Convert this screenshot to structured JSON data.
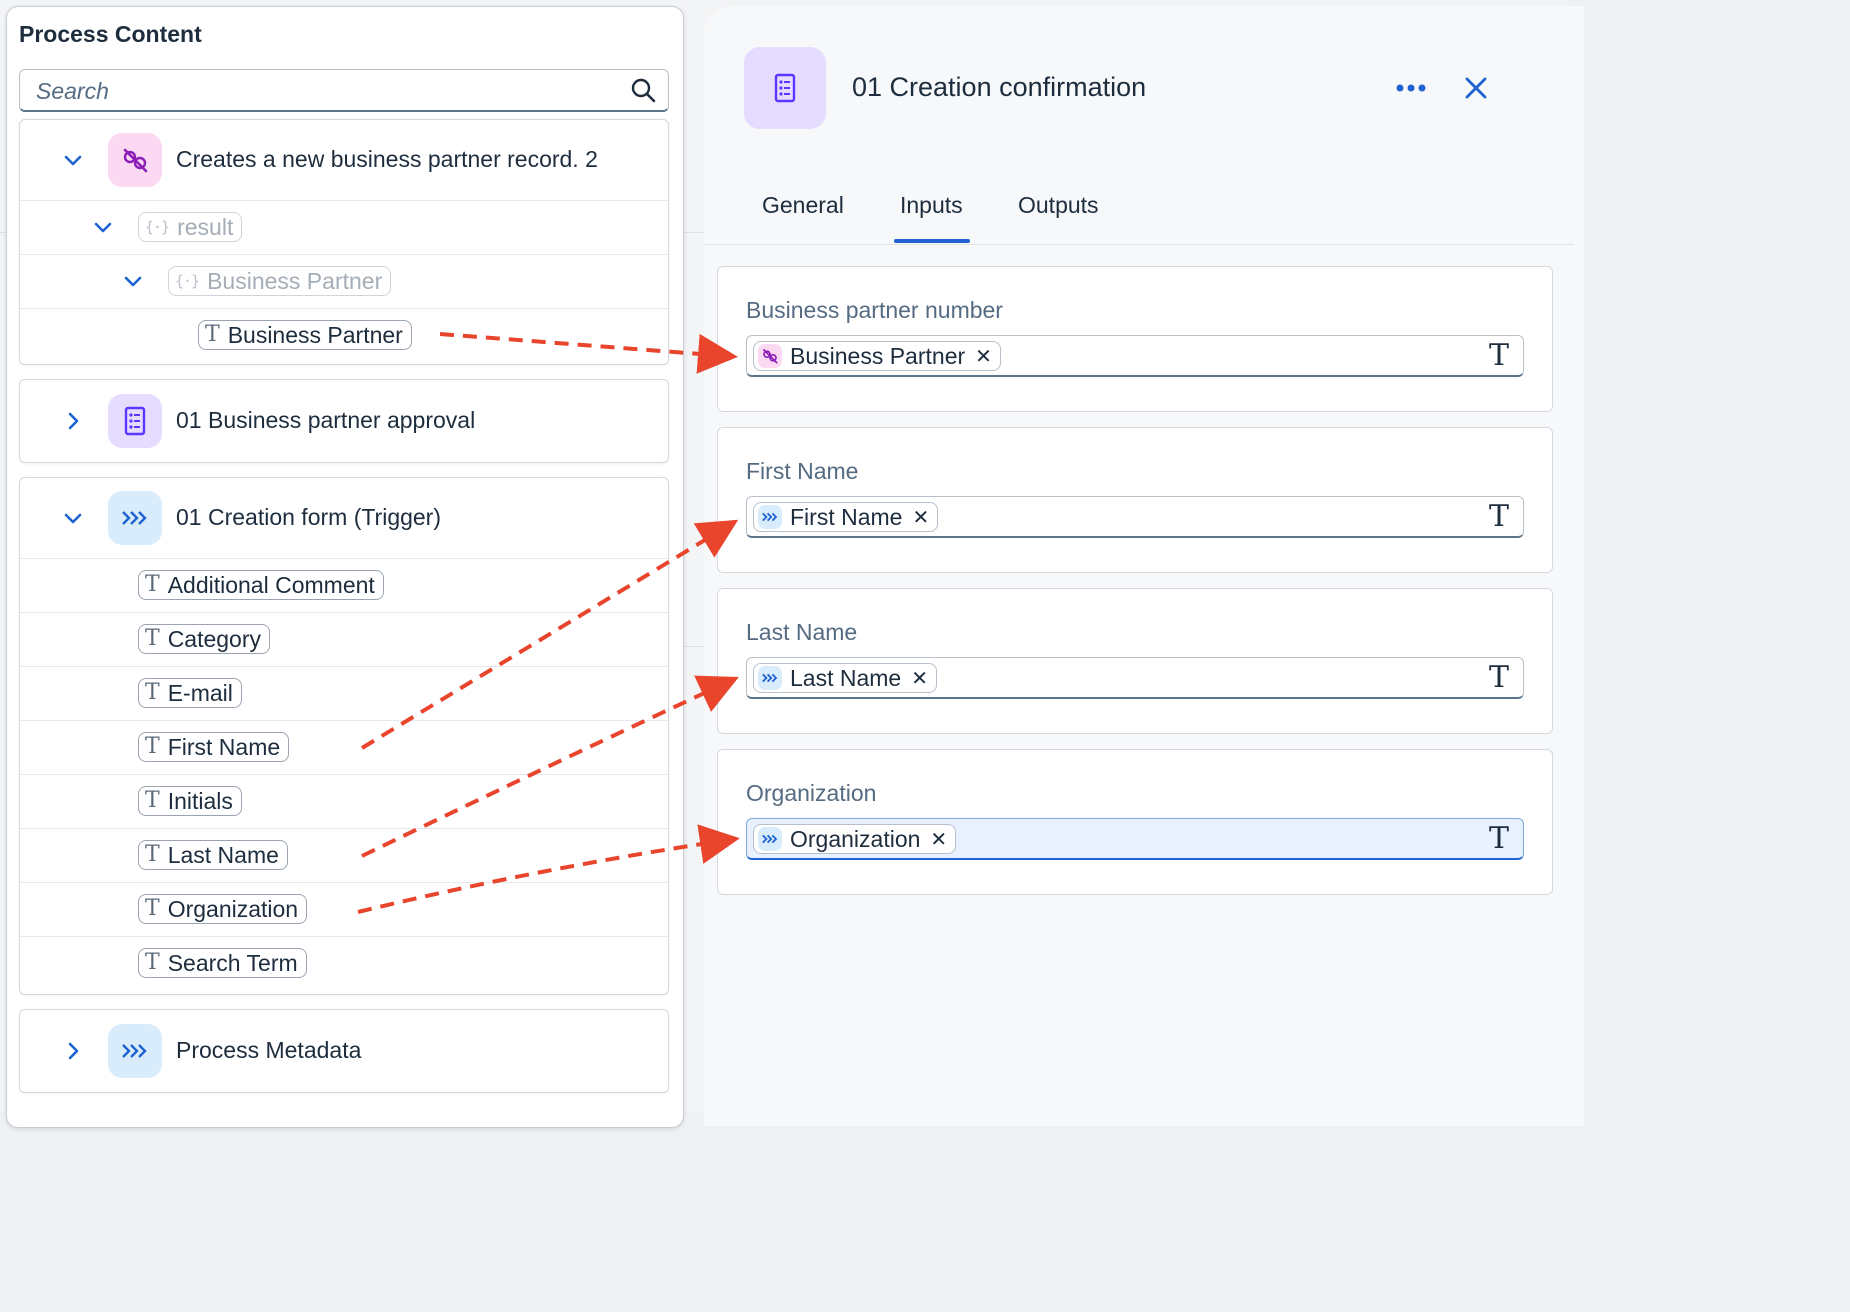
{
  "left_panel": {
    "title": "Process Content",
    "search_placeholder": "Search",
    "groups": [
      {
        "label": "Creates a new business partner record. 2",
        "children": [
          {
            "label": "result"
          },
          {
            "label": "Business Partner"
          },
          {
            "label": "Business Partner"
          }
        ]
      },
      {
        "label": "01 Business partner approval"
      },
      {
        "label": "01 Creation form (Trigger)",
        "children": [
          {
            "label": "Additional Comment"
          },
          {
            "label": "Category"
          },
          {
            "label": "E-mail"
          },
          {
            "label": "First Name"
          },
          {
            "label": "Initials"
          },
          {
            "label": "Last Name"
          },
          {
            "label": "Organization"
          },
          {
            "label": "Search Term"
          }
        ]
      },
      {
        "label": "Process Metadata"
      }
    ]
  },
  "right_panel": {
    "title": "01 Creation confirmation",
    "tabs": [
      "General",
      "Inputs",
      "Outputs"
    ],
    "active_tab": "Inputs",
    "fields": [
      {
        "label": "Business partner number",
        "token": "Business Partner"
      },
      {
        "label": "First Name",
        "token": "First Name"
      },
      {
        "label": "Last Name",
        "token": "Last Name"
      },
      {
        "label": "Organization",
        "token": "Organization"
      }
    ],
    "type_glyph": "T",
    "remove_glyph": "✕"
  },
  "colors": {
    "accent_blue": "#1e63d1",
    "arrow_red": "#e8452c",
    "action_icon_bg": "#fbd9f2",
    "action_icon_fg": "#8c1fb8",
    "approval_icon_bg": "#e5dcff",
    "approval_icon_fg": "#5d36ff",
    "trigger_icon_bg": "#d9ecfb",
    "trigger_icon_fg": "#1e63d1"
  },
  "icons": {
    "search": "search-icon",
    "chevron_down": "chevron-down-icon",
    "chevron_right": "chevron-right-icon",
    "action": "action-link-icon",
    "form": "form-document-icon",
    "trigger": "trigger-chevrons-icon",
    "text_type": "text-type-icon",
    "object": "object-curly-icon",
    "more": "more-dots-icon",
    "close": "close-icon"
  }
}
